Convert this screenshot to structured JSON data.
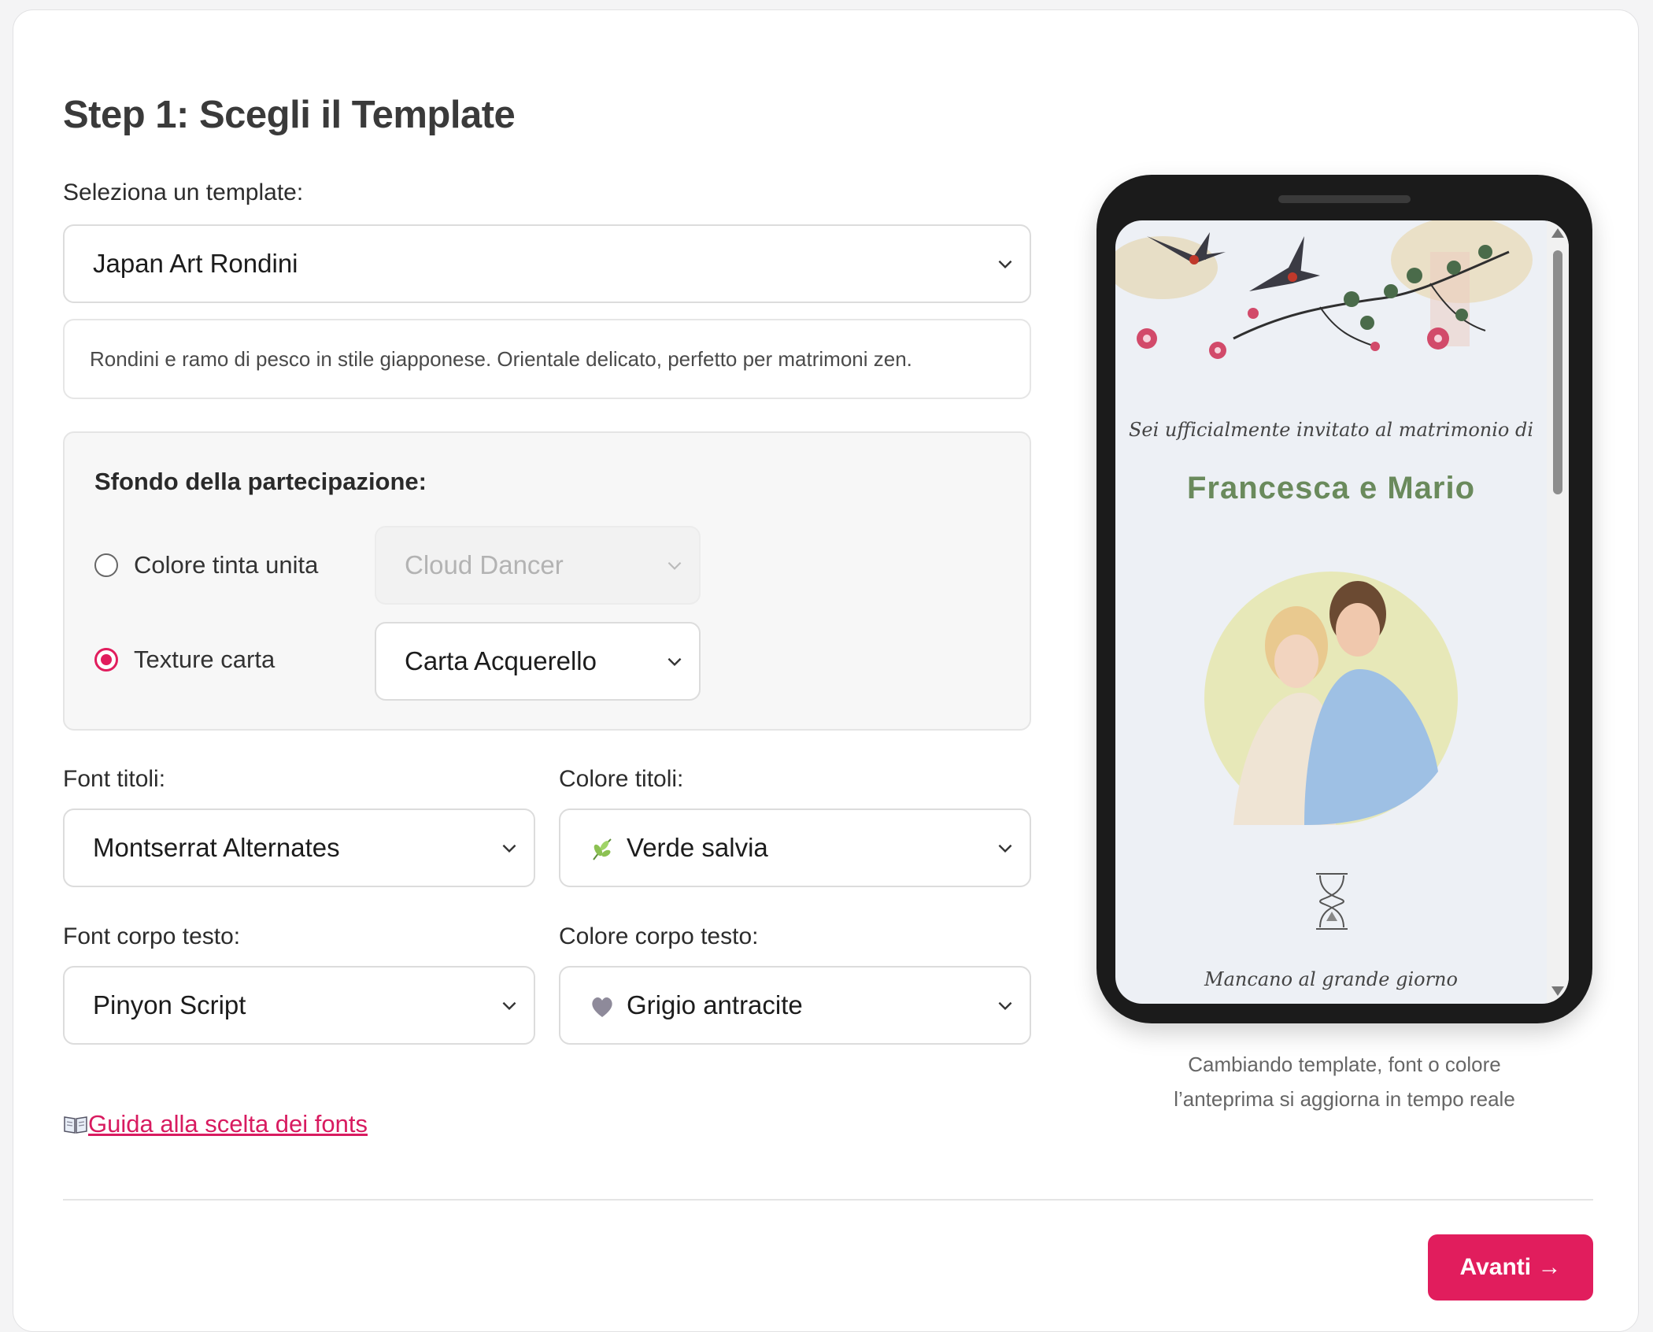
{
  "step": {
    "title": "Step 1: Scegli il Template"
  },
  "template": {
    "label": "Seleziona un template:",
    "selected": "Japan Art Rondini",
    "description": "Rondini e ramo di pesco in stile giapponese. Orientale delicato, perfetto per matrimoni zen."
  },
  "background": {
    "title": "Sfondo della partecipazione:",
    "options": [
      {
        "label": "Colore tinta unita",
        "checked": false,
        "select_value": "Cloud Dancer",
        "disabled": true
      },
      {
        "label": "Texture carta",
        "checked": true,
        "select_value": "Carta Acquerello",
        "disabled": false
      }
    ]
  },
  "fonts": {
    "title_font_label": "Font titoli:",
    "title_font_value": "Montserrat Alternates",
    "title_color_label": "Colore titoli:",
    "title_color_value": "Verde salvia",
    "title_color_icon": "herb-icon",
    "body_font_label": "Font corpo testo:",
    "body_font_value": "Pinyon Script",
    "body_color_label": "Colore corpo testo:",
    "body_color_value": "Grigio antracite",
    "body_color_icon": "grey-heart-icon"
  },
  "guide": {
    "icon": "open-book-icon",
    "link": " Guida alla scelta dei fonts"
  },
  "preview": {
    "invite_line": "Sei ufficialmente invitato al matrimonio di",
    "couple": "Francesca e Mario",
    "countdown_label": "Mancano al grande giorno",
    "caption_line1": "Cambiando template, font o colore",
    "caption_line2": "l’anteprima si aggiorna in tempo reale"
  },
  "nav": {
    "next": "Avanti →"
  },
  "colors": {
    "accent": "#e11d5d",
    "sage": "#6a8a5c",
    "title_text": "#3a3a3a"
  }
}
